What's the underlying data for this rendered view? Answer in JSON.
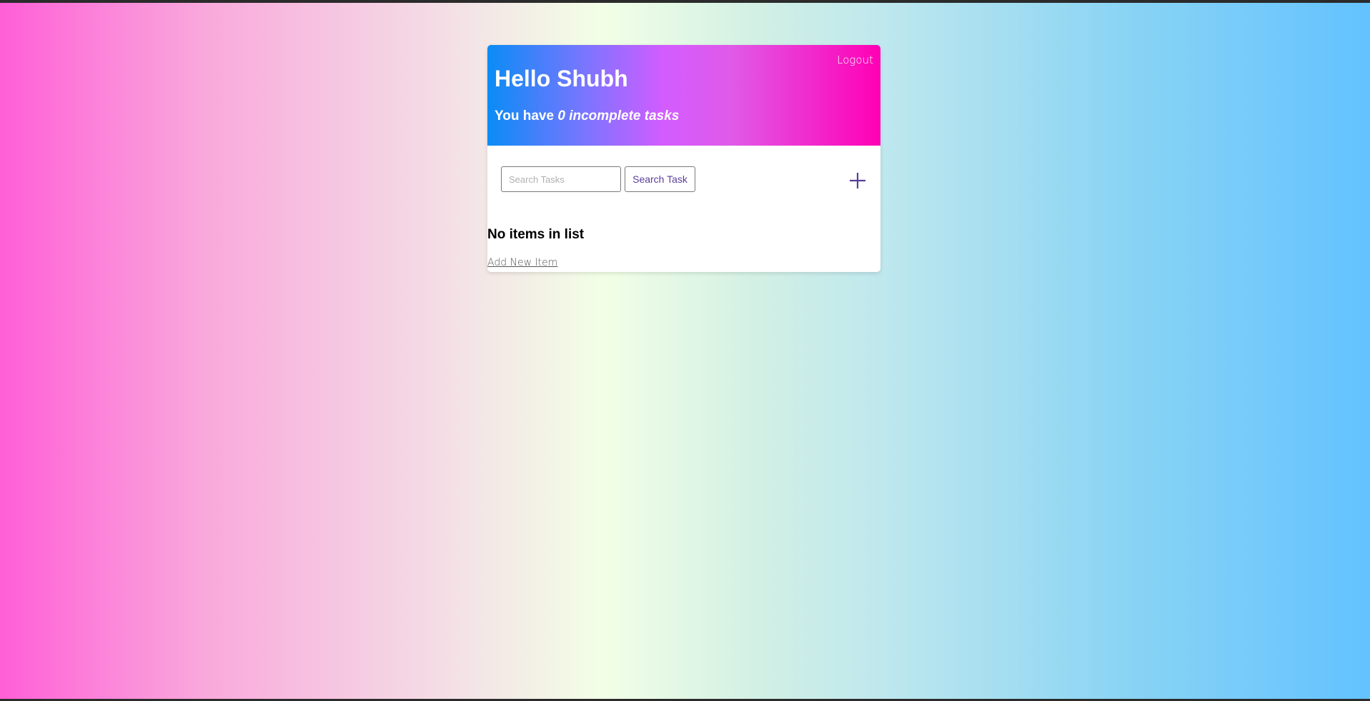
{
  "header": {
    "logout_label": "Logout",
    "greeting": "Hello Shubh",
    "summary_prefix": "You have ",
    "summary_emphasis": "0 incomplete tasks"
  },
  "search": {
    "placeholder": "Search Tasks",
    "value": "",
    "button_label": "Search Task"
  },
  "add_button": {
    "icon": "plus-icon"
  },
  "list": {
    "empty_message": "No items in list",
    "add_link_label": "Add New Item"
  },
  "colors": {
    "accent": "#5a3d9a",
    "header_gradient": [
      "#0a8cf5",
      "#d35cff",
      "#ff00b5"
    ],
    "page_gradient": [
      "#ff5fd7",
      "#f2ffe6",
      "#63c2ff"
    ]
  }
}
